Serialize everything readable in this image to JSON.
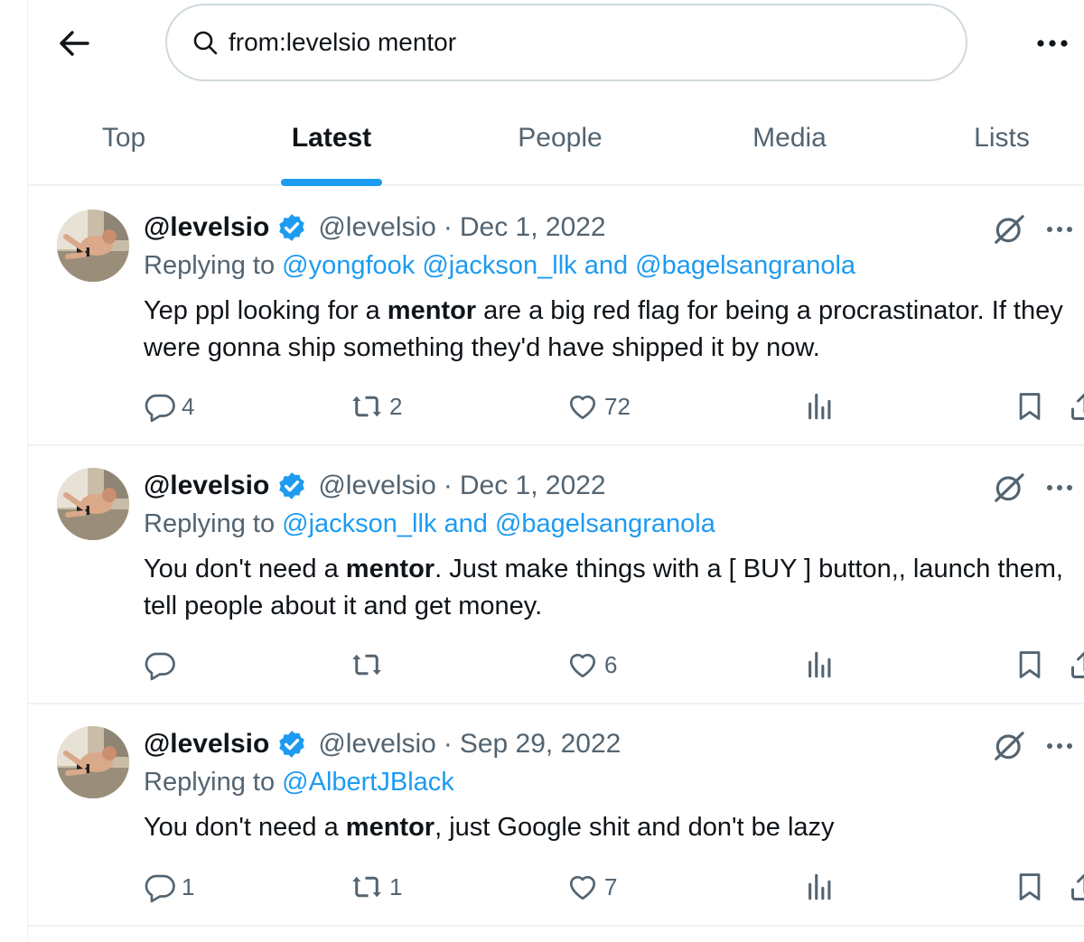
{
  "search": {
    "value": "from:levelsio mentor"
  },
  "tabs": [
    {
      "label": "Top",
      "active": false
    },
    {
      "label": "Latest",
      "active": true
    },
    {
      "label": "People",
      "active": false
    },
    {
      "label": "Media",
      "active": false
    },
    {
      "label": "Lists",
      "active": false
    }
  ],
  "colors": {
    "accent": "#1d9bf0",
    "text": "#0f1419",
    "muted": "#536471",
    "border": "#eff3f4"
  },
  "tweets": [
    {
      "name": "@levelsio",
      "handle": "@levelsio",
      "separator": "·",
      "date": "Dec 1, 2022",
      "replying_prefix": "Replying to",
      "reply_to": [
        "@yongfook",
        "@jackson_llk",
        "and",
        "@bagelsangranola"
      ],
      "text_before": "Yep ppl looking for a ",
      "highlight": "mentor",
      "text_after": " are a big red flag for being a procrastinator. If they were gonna ship something they'd have shipped it by now.",
      "replies": "4",
      "retweets": "2",
      "likes": "72"
    },
    {
      "name": "@levelsio",
      "handle": "@levelsio",
      "separator": "·",
      "date": "Dec 1, 2022",
      "replying_prefix": "Replying to",
      "reply_to": [
        "@jackson_llk",
        "and",
        "@bagelsangranola"
      ],
      "text_before": "You don't need a ",
      "highlight": "mentor",
      "text_after": ". Just make things with a [ BUY ] button,, launch them, tell people about it and get money.",
      "replies": "",
      "retweets": "",
      "likes": "6"
    },
    {
      "name": "@levelsio",
      "handle": "@levelsio",
      "separator": "·",
      "date": "Sep 29, 2022",
      "replying_prefix": "Replying to",
      "reply_to": [
        "@AlbertJBlack"
      ],
      "text_before": "You don't need a ",
      "highlight": "mentor",
      "text_after": ", just Google shit and don't be lazy",
      "replies": "1",
      "retweets": "1",
      "likes": "7"
    }
  ]
}
